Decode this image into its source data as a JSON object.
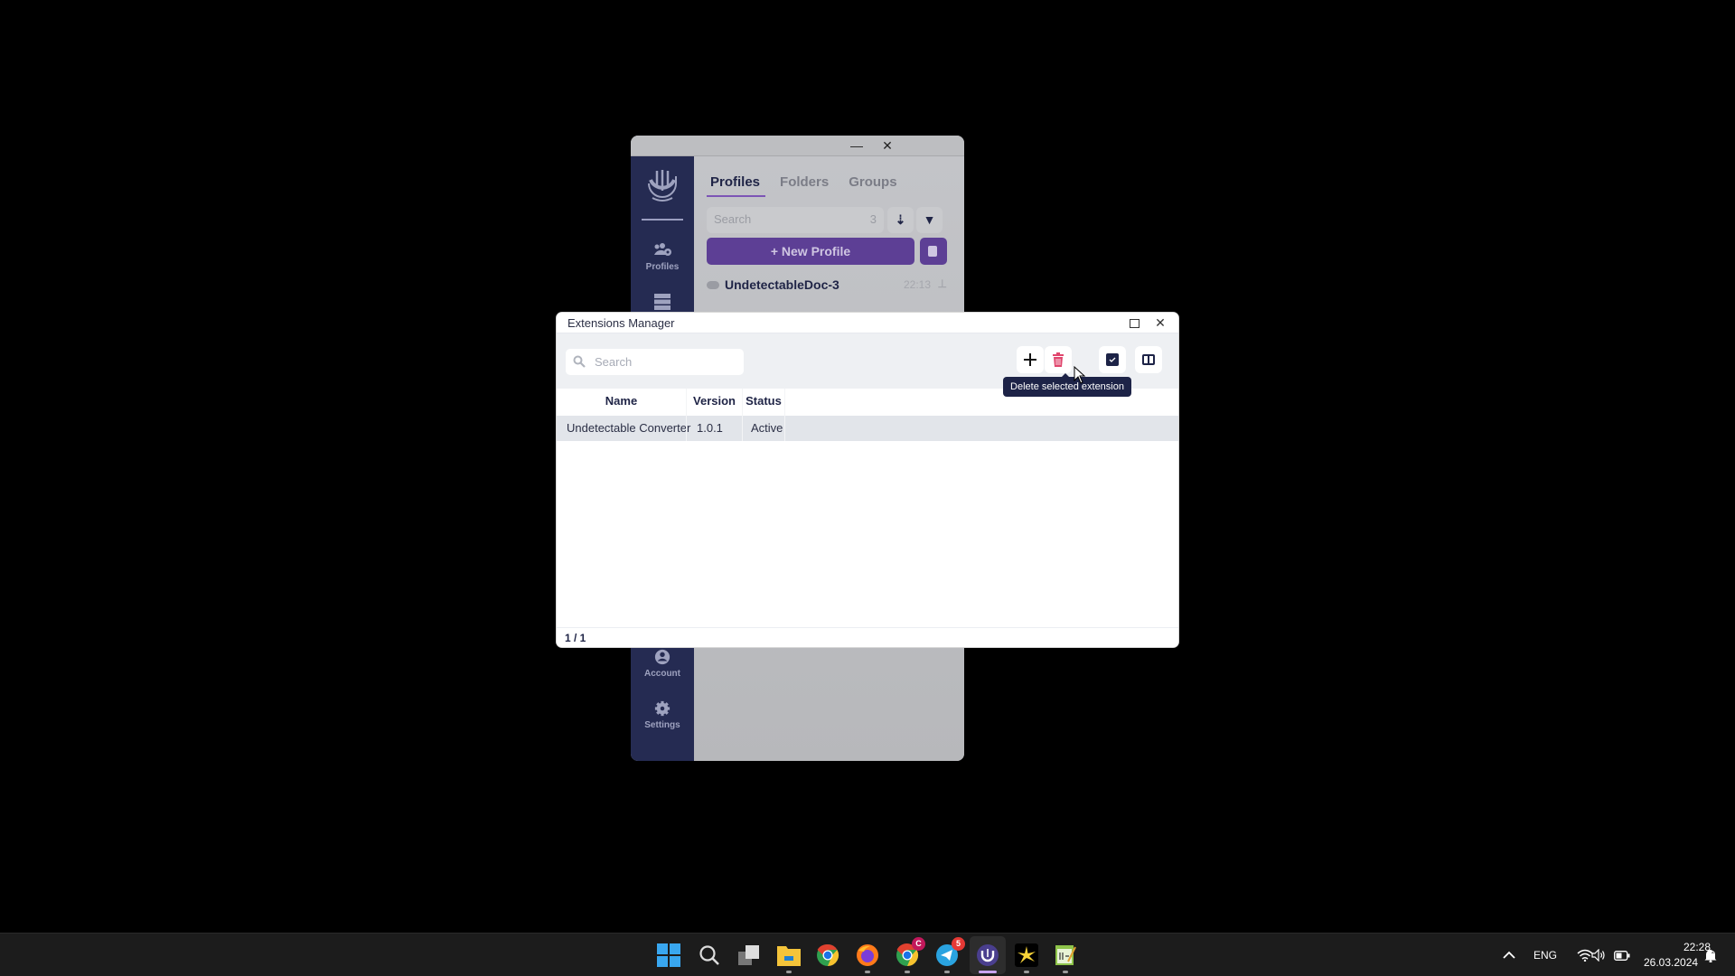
{
  "background_app": {
    "window_controls": {
      "minimize": "—",
      "close": "✕"
    },
    "sidebar": {
      "items": [
        {
          "label": "Profiles",
          "icon": "users-gear-icon"
        },
        {
          "label": "",
          "icon": "server-icon"
        },
        {
          "label": "Account",
          "icon": "account-icon"
        },
        {
          "label": "Settings",
          "icon": "gear-icon"
        }
      ]
    },
    "tabs": [
      {
        "label": "Profiles",
        "active": true
      },
      {
        "label": "Folders",
        "active": false
      },
      {
        "label": "Groups",
        "active": false
      }
    ],
    "search": {
      "placeholder": "Search",
      "count": "3"
    },
    "new_profile_label": "+ New Profile",
    "profile": {
      "name": "UndetectableDoc-3",
      "time": "22:13"
    }
  },
  "dialog": {
    "title": "Extensions Manager",
    "search_placeholder": "Search",
    "toolbar": {
      "add": "add-extension",
      "delete": "delete-extension",
      "select": "select-all",
      "columns": "columns-view"
    },
    "tooltip": "Delete selected extension",
    "columns": [
      "Name",
      "Version",
      "Status"
    ],
    "rows": [
      {
        "name": "Undetectable Converter",
        "version": "1.0.1",
        "status": "Active",
        "selected": true
      }
    ],
    "footer": "1 / 1",
    "colors": {
      "delete": "#e0466d",
      "accent": "#1d2347"
    }
  },
  "taskbar": {
    "apps": [
      {
        "name": "start"
      },
      {
        "name": "search"
      },
      {
        "name": "task-view"
      },
      {
        "name": "file-explorer"
      },
      {
        "name": "chrome"
      },
      {
        "name": "firefox"
      },
      {
        "name": "chrome-profile",
        "badge": "C"
      },
      {
        "name": "telegram",
        "badge": "5"
      },
      {
        "name": "undetectable",
        "active": true
      },
      {
        "name": "app-star"
      },
      {
        "name": "notepad-plus"
      }
    ],
    "language": "ENG",
    "time": "22:28",
    "date": "26.03.2024"
  }
}
